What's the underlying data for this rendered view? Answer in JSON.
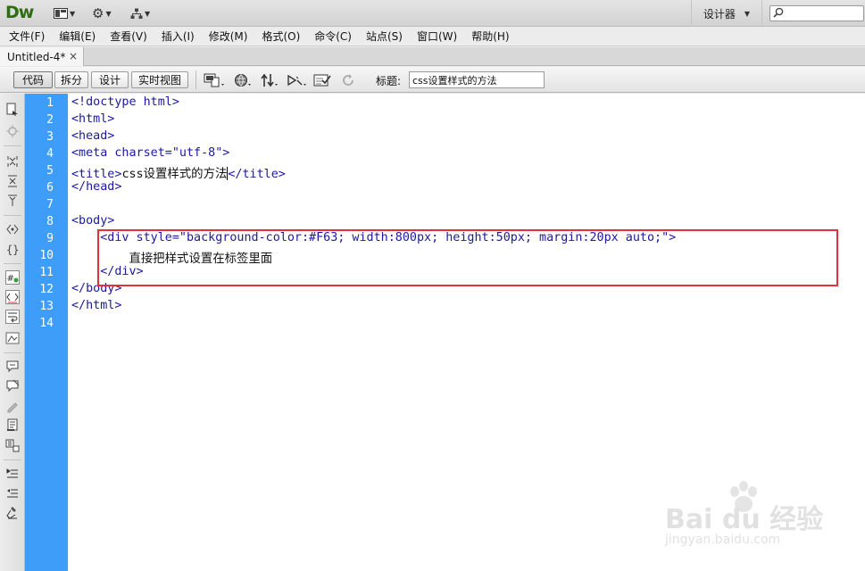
{
  "app": {
    "logo": "Dw",
    "workspace_label": "设计器",
    "search_placeholder": ""
  },
  "menu": [
    "文件(F)",
    "编辑(E)",
    "查看(V)",
    "插入(I)",
    "修改(M)",
    "格式(O)",
    "命令(C)",
    "站点(S)",
    "窗口(W)",
    "帮助(H)"
  ],
  "document_tab": {
    "label": "Untitled-4*",
    "close_label": "×"
  },
  "view_buttons": [
    "代码",
    "拆分",
    "设计",
    "实时视图"
  ],
  "title_field": {
    "label": "标题:",
    "value": "css设置样式的方法"
  },
  "line_numbers": [
    "1",
    "2",
    "3",
    "4",
    "5",
    "6",
    "7",
    "8",
    "9",
    "10",
    "11",
    "12",
    "13",
    "14"
  ],
  "code_lines": [
    "<!doctype html>",
    "<html>",
    "<head>",
    "<meta charset=\"utf-8\">",
    "<title>",
    "</head>",
    "",
    "<body>",
    "    <div style=\"background-color:#F63; width:800px; height:50px; margin:20px auto;\">",
    "        ",
    "    </div>",
    "</body>",
    "</html>",
    ""
  ],
  "title_code": {
    "open": "<title>",
    "text": "css设置样式的方法",
    "close": "</title>"
  },
  "div_content": "直接把样式设置在标签里面",
  "watermark": {
    "brand": "Bai du 经验",
    "url": "jingyan.baidu.com"
  },
  "colors": {
    "gutter": "#3d9df9",
    "code_tag": "#1a1aa0",
    "highlight_border": "#e0323a",
    "logo": "#2e6e10"
  }
}
